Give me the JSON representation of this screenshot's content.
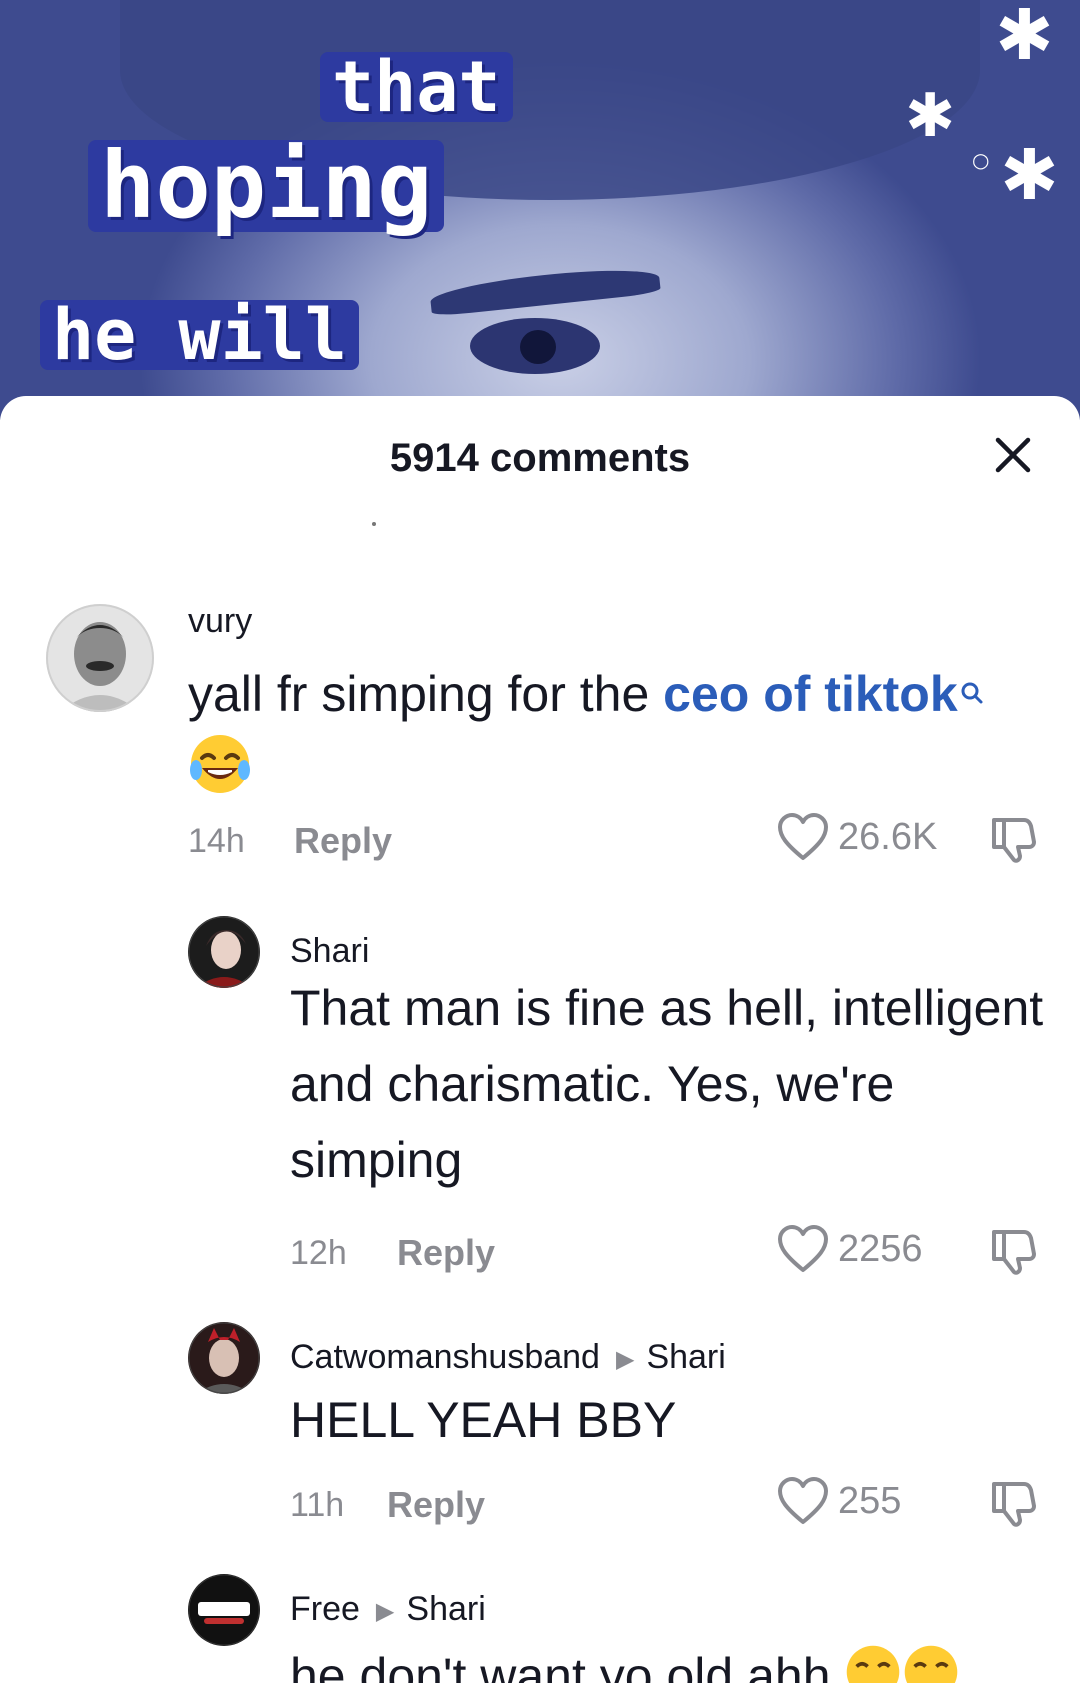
{
  "video": {
    "caption_words": [
      "that",
      "hoping",
      "he will"
    ]
  },
  "sheet": {
    "title": "5914 comments"
  },
  "comments": [
    {
      "username": "vury",
      "text_before": "yall fr simping for the ",
      "text_link": "ceo of tiktok",
      "time": "14h",
      "reply": "Reply",
      "likes": "26.6K"
    },
    {
      "username": "Shari",
      "text": "That man is fine as hell, intelligent and charismatic. Yes, we're simping",
      "time": "12h",
      "reply": "Reply",
      "likes": "2256"
    },
    {
      "username": "Catwomanshusband",
      "reply_to": "Shari",
      "text": "HELL YEAH BBY",
      "time": "11h",
      "reply": "Reply",
      "likes": "255"
    },
    {
      "username": "Free",
      "reply_to": "Shari",
      "text": "he don't want yo old ahh"
    }
  ],
  "colors": {
    "link": "#2b5db9",
    "muted": "#8a8b91",
    "text": "#161823",
    "caption_bg": "#2d3aa0"
  }
}
